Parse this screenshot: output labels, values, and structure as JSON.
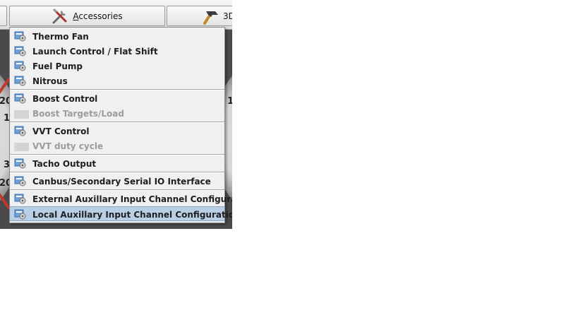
{
  "toolbar": {
    "accessories_prefix": "A",
    "accessories_rest": "ccessories",
    "next_button_label": "3D"
  },
  "gauge": {
    "numbers": [
      "20",
      "1",
      "1",
      "3",
      "20"
    ]
  },
  "menu": {
    "items": [
      {
        "label": "Thermo Fan",
        "enabled": true
      },
      {
        "label": "Launch Control / Flat Shift",
        "enabled": true
      },
      {
        "label": "Fuel Pump",
        "enabled": true
      },
      {
        "label": "Nitrous",
        "enabled": true
      },
      {
        "label": "Boost Control",
        "enabled": true
      },
      {
        "label": "Boost Targets/Load",
        "enabled": false
      },
      {
        "label": "VVT Control",
        "enabled": true
      },
      {
        "label": "VVT duty cycle",
        "enabled": false
      },
      {
        "label": "Tacho Output",
        "enabled": true
      },
      {
        "label": "Canbus/Secondary Serial IO Interface",
        "enabled": true
      },
      {
        "label": "External Auxillary Input Channel Configuration",
        "enabled": true
      },
      {
        "label": "Local Auxillary Input Channel Configuration",
        "enabled": true,
        "selected": true
      }
    ],
    "icon": "settings-dialog-icon"
  },
  "colors": {
    "selection": "#b8cfe5",
    "menu_bg": "#f0f0f0",
    "disabled_text": "#9c9c9c"
  }
}
